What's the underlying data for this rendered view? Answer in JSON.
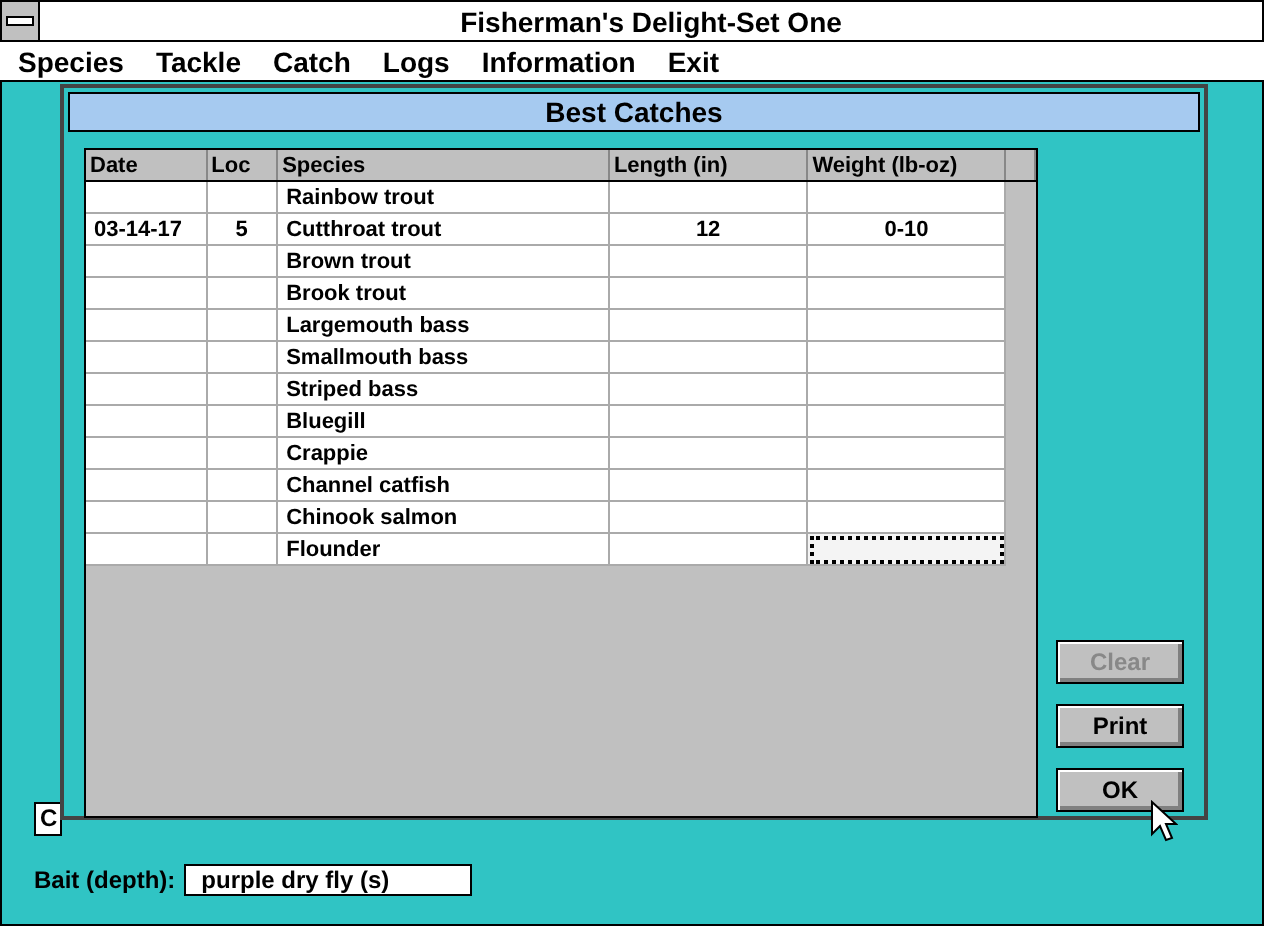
{
  "window": {
    "title": "Fisherman's Delight-Set One"
  },
  "menu": [
    "Species",
    "Tackle",
    "Catch",
    "Logs",
    "Information",
    "Exit"
  ],
  "background": {
    "clipped_label": "C",
    "bait_label": "Bait (depth):",
    "bait_value": "purple dry fly (s)"
  },
  "dialog": {
    "title": "Best Catches",
    "table": {
      "columns": [
        "Date",
        "Loc",
        "Species",
        "Length (in)",
        "Weight (lb-oz)"
      ],
      "rows": [
        {
          "date": "",
          "loc": "",
          "species": "Rainbow trout",
          "length": "",
          "weight": "",
          "focused": false
        },
        {
          "date": "03-14-17",
          "loc": "5",
          "species": "Cutthroat trout",
          "length": "12",
          "weight": "0-10",
          "focused": false
        },
        {
          "date": "",
          "loc": "",
          "species": "Brown trout",
          "length": "",
          "weight": "",
          "focused": false
        },
        {
          "date": "",
          "loc": "",
          "species": "Brook trout",
          "length": "",
          "weight": "",
          "focused": false
        },
        {
          "date": "",
          "loc": "",
          "species": "Largemouth bass",
          "length": "",
          "weight": "",
          "focused": false
        },
        {
          "date": "",
          "loc": "",
          "species": "Smallmouth bass",
          "length": "",
          "weight": "",
          "focused": false
        },
        {
          "date": "",
          "loc": "",
          "species": "Striped bass",
          "length": "",
          "weight": "",
          "focused": false
        },
        {
          "date": "",
          "loc": "",
          "species": "Bluegill",
          "length": "",
          "weight": "",
          "focused": false
        },
        {
          "date": "",
          "loc": "",
          "species": "Crappie",
          "length": "",
          "weight": "",
          "focused": false
        },
        {
          "date": "",
          "loc": "",
          "species": "Channel catfish",
          "length": "",
          "weight": "",
          "focused": false
        },
        {
          "date": "",
          "loc": "",
          "species": "Chinook salmon",
          "length": "",
          "weight": "",
          "focused": false
        },
        {
          "date": "",
          "loc": "",
          "species": "Flounder",
          "length": "",
          "weight": "",
          "focused": true
        }
      ]
    },
    "buttons": [
      {
        "label": "Clear",
        "disabled": true
      },
      {
        "label": "Print",
        "disabled": false
      },
      {
        "label": "OK",
        "disabled": false
      }
    ]
  }
}
